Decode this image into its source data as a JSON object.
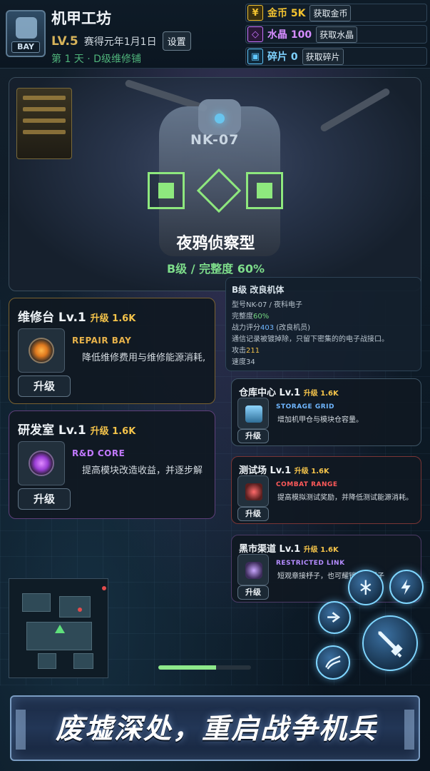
{
  "header": {
    "badge": "BAY",
    "title": "机甲工坊",
    "level": "LV.5",
    "date": "赛得元年1月1日",
    "settings_label": "设置",
    "day_info": "第 1 天 · D级维修铺"
  },
  "resources": [
    {
      "icon": "¥",
      "label": "金币 5K",
      "button": "获取金币",
      "color": "#f2c230"
    },
    {
      "icon": "◇",
      "label": "水晶 100",
      "button": "获取水晶",
      "color": "#c874ff"
    },
    {
      "icon": "▣",
      "label": "碎片 0",
      "button": "获取碎片",
      "color": "#5fc8ff"
    }
  ],
  "hero": {
    "code": "NK-07",
    "name": "夜鸦侦察型",
    "grade": "B级 / 完整度 60%"
  },
  "info": {
    "heading": "B级  改良机体",
    "model": "型号NK-07 / 夜科电子",
    "integrity_label": "完整度",
    "integrity_value": "60%",
    "power_label": "战力评分",
    "power_value": "403",
    "power_note": "(改良机员)",
    "description": "通信记录被镀掉除，只留下密集的的电子战接口。",
    "attack_label": "攻击",
    "attack_value": "211",
    "speed_label": "速度",
    "speed_value": "34"
  },
  "facilities": {
    "repair": {
      "name": "维修台 Lv.1",
      "upgrade_cost": "升级 1.6K",
      "sub": "REPAIR BAY",
      "desc": "降低维修费用与维修能源消耗,",
      "button": "升级",
      "accent": "#e7b24a"
    },
    "rnd": {
      "name": "研发室 Lv.1",
      "upgrade_cost": "升级 1.6K",
      "sub": "R&D CORE",
      "desc": "提高模块改造收益，并逐步解",
      "button": "升级",
      "accent": "#c279ff"
    },
    "storage": {
      "name": "仓库中心 Lv.1",
      "upgrade_cost": "升级 1.6K",
      "sub": "STORAGE GRID",
      "desc": "增加机甲仓与模块仓容量。",
      "button": "升级",
      "accent": "#6fb6ff"
    },
    "test": {
      "name": "测试场 Lv.1",
      "upgrade_cost": "升级 1.6K",
      "sub": "COMBAT RANGE",
      "desc": "提高模拟测试奖励，并降低测试能源消耗。",
      "button": "升级",
      "accent": "#ff5a5a"
    },
    "black": {
      "name": "黑市渠道 Lv.1",
      "upgrade_cost": "升级 1.6K",
      "sub": "RESTRICTED LINK",
      "desc": "短观章接杼子，也可耀销家章杼子",
      "button": "升级",
      "accent": "#b48cff"
    }
  },
  "player_hp": 0.62,
  "banner": {
    "text": "废墟深处，重启战争机兵"
  },
  "icons": [
    "mech-icon",
    "coin-icon",
    "crystal-icon",
    "shard-icon",
    "repair-core-icon",
    "rnd-core-icon",
    "storage-icon",
    "combat-icon",
    "black-market-icon",
    "skill-bug-icon",
    "skill-lightning-icon",
    "skill-dash-icon",
    "skill-wave-icon",
    "attack-sword-icon"
  ]
}
